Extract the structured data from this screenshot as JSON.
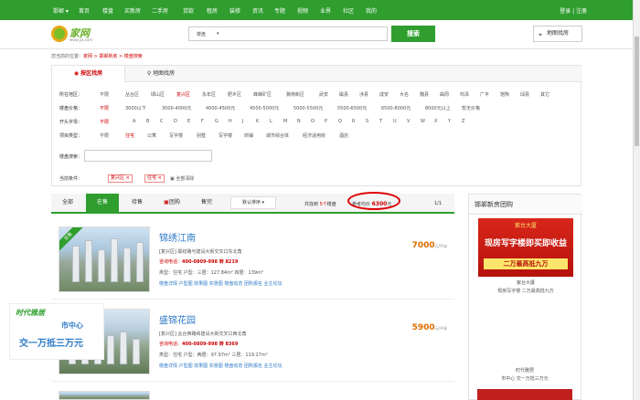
{
  "topnav": {
    "city": "邯郸 ▾",
    "items": [
      "首页",
      "楼盘",
      "买新房",
      "二手房",
      "贷款",
      "租房",
      "装修",
      "资讯",
      "专题",
      "视频",
      "业界",
      "社区",
      "我的"
    ],
    "login": "登录 | 注册"
  },
  "header": {
    "logo_brand": "家网",
    "logo_url": "www.jia.com",
    "search_type": "楼盘",
    "search_arrow": "▾",
    "search_button": "搜索",
    "map_button": "地图找房"
  },
  "breadcrumb": {
    "prefix": "您当前的位置：",
    "path": "家网 > 邯郸新房 > 楼盘搜索"
  },
  "filters": {
    "tab_area": "按区找房",
    "tab_map": "地图找房",
    "rows": [
      {
        "label": "所在地区：",
        "options": [
          "不限",
          "丛台区",
          "邯山区",
          "复兴区",
          "永年区",
          "肥乡区",
          "峰峰矿区",
          "冀南新区",
          "武安",
          "磁县",
          "涉县",
          "成安",
          "大名",
          "魏县",
          "曲周",
          "鸡泽",
          "广平",
          "馆陶",
          "邱县",
          "其它"
        ]
      },
      {
        "label": "楼盘价格：",
        "options": [
          "不限",
          "3000以下",
          "3000-4000元",
          "4000-4500元",
          "4500-5000元",
          "5000-5500元",
          "5500-6500元",
          "6500-8000元",
          "8000元以上",
          "暂无价格"
        ]
      },
      {
        "label": "开头字母：",
        "options": [
          "不限",
          "A",
          "B",
          "C",
          "D",
          "E",
          "F",
          "G",
          "H",
          "J",
          "K",
          "L",
          "M",
          "N",
          "O",
          "P",
          "Q",
          "R",
          "S",
          "T",
          "U",
          "V",
          "W",
          "X",
          "Y",
          "Z"
        ]
      },
      {
        "label": "项目类型：",
        "options": [
          "不限",
          "住宅",
          "公寓",
          "写字楼",
          "别墅",
          "写字楼",
          "商铺",
          "城市综合体",
          "经济适用房",
          "酒店"
        ]
      }
    ],
    "keyword_label": "楼盘搜索：",
    "current_label": "当前条件：",
    "cond1": "复兴区 ×",
    "cond2": "住宅 ×",
    "clear_all": "全部清除"
  },
  "sortbar": {
    "tabs": [
      "全部",
      "在售",
      "待售",
      "团购",
      "售完"
    ],
    "sort_default": "默认排序 ▾",
    "total_prefix": "共找到",
    "total_num": "5个",
    "total_suffix": "楼盘",
    "avg_label": "参考均价",
    "avg_value": "6300",
    "avg_unit": "元",
    "pager": "1/1"
  },
  "listings": [
    {
      "title": "锦绣江南",
      "address": "[复兴区] 联纺路与建设大街交叉口东北角",
      "phone_label": "咨询电话：",
      "phone": "400-0809-998 转 8219",
      "types": "类型：住宅 户型：三居：127.84m²  四居：139m²",
      "links": "楼盘详情 户型图 效果图 实景图 楼盘动态 团购报名 业主论坛",
      "price": "7000",
      "price_unit": "元/平米",
      "badge": "在售"
    },
    {
      "title": "盛锦花园",
      "address": "[复兴区] 丛台西路和建设大街交叉口西北角",
      "phone_label": "咨询电话：",
      "phone": "400-0809-998 转 8369",
      "types": "类型：住宅 户型：两居：97.97m²  三居：119.27m²",
      "links": "楼盘详情 户型图 效果图 实景图 楼盘动态 团购报名 业主论坛",
      "price": "5900",
      "price_unit": "元/平米",
      "badge": "售罄"
    },
    {
      "title": "",
      "address": "",
      "phone_label": "",
      "phone": "",
      "types": "",
      "links": "",
      "price": "",
      "price_unit": "",
      "badge": ""
    }
  ],
  "sidebar": {
    "title": "邯郸新房团购",
    "ad1_top": "紫台大厦",
    "ad1_mid": "现房写字楼即买即收益",
    "ad1_bot": "二万最高抵九万",
    "ad1_cap1": "紫台大厦",
    "ad1_cap2": "现房写字楼  二万最高抵九万",
    "ad2_brand": "时代雅居",
    "ad2_l1": "市中心",
    "ad2_l2": "交一万抵三万元",
    "ad2_cap1": "时代雅居",
    "ad2_cap2": "市中心  交一万抵三万元"
  },
  "colors": {
    "brand_green": "#2f9e2f",
    "link_blue": "#2f7bc8",
    "price_orange": "#e06c00",
    "accent_red": "#c00"
  }
}
